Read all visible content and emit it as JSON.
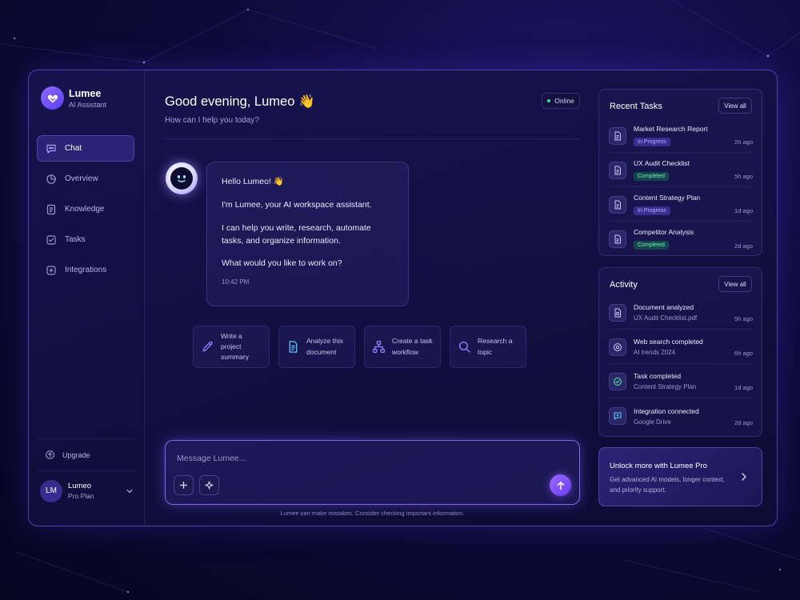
{
  "brand": {
    "name": "Lumee",
    "subtitle": "AI Assistant"
  },
  "nav": [
    {
      "label": "Chat",
      "icon": "chat-icon",
      "active": true
    },
    {
      "label": "Overview",
      "icon": "overview-icon",
      "active": false
    },
    {
      "label": "Knowledge",
      "icon": "document-icon",
      "active": false
    },
    {
      "label": "Tasks",
      "icon": "checkbox-icon",
      "active": false
    },
    {
      "label": "Integrations",
      "icon": "integrations-icon",
      "active": false
    }
  ],
  "upgrade": {
    "label": "Upgrade",
    "icon": "upgrade-icon"
  },
  "user": {
    "initials": "LM",
    "name": "Lumeo",
    "plan": "Pro Plan"
  },
  "header": {
    "greeting": "Good evening, Lumeo 👋",
    "subtitle": "How can I help you today?",
    "status": "Online"
  },
  "message": {
    "line1": "Hello Lumeo! 👋",
    "line2": "I'm Lumee, your AI workspace assistant.",
    "line3": "I can help you write, research, automate tasks, and organize information.",
    "line4": "What would you like to work on?",
    "time": "10:42 PM"
  },
  "suggestions": [
    {
      "line1": "Write a project",
      "line2": "summary",
      "icon": "pencil-icon"
    },
    {
      "line1": "Analyze this",
      "line2": "document",
      "icon": "document-icon"
    },
    {
      "line1": "Create a task",
      "line2": "workflow",
      "icon": "workflow-icon"
    },
    {
      "line1": "Research a",
      "line2": "topic",
      "icon": "search-icon"
    }
  ],
  "composer": {
    "placeholder": "Message Lumee...",
    "disclaimer": "Lumee can make mistakes. Consider checking important information."
  },
  "recent_tasks": {
    "title": "Recent Tasks",
    "view_all": "View all",
    "items": [
      {
        "title": "Market Research Report",
        "status": "In Progress",
        "time": "2h ago"
      },
      {
        "title": "UX Audit Checklist",
        "status": "Completed",
        "time": "5h ago"
      },
      {
        "title": "Content Strategy Plan",
        "status": "In Progress",
        "time": "1d ago"
      },
      {
        "title": "Competitor Analysis",
        "status": "Completed",
        "time": "2d ago"
      }
    ]
  },
  "activity": {
    "title": "Activity",
    "view_all": "View all",
    "items": [
      {
        "title": "Document analyzed",
        "sub": "UX Audit Checklist.pdf",
        "time": "5h ago",
        "icon": "file-icon"
      },
      {
        "title": "Web search completed",
        "sub": "AI trends 2024",
        "time": "6h ago",
        "icon": "globe-icon"
      },
      {
        "title": "Task completed",
        "sub": "Content Strategy Plan",
        "time": "1d ago",
        "icon": "check-circle-icon"
      },
      {
        "title": "Integration connected",
        "sub": "Google Drive",
        "time": "2d ago",
        "icon": "integration-chat-icon"
      }
    ]
  },
  "promo": {
    "title": "Unlock more with Lumee Pro",
    "desc": "Get advanced AI models, longer context, and priority support."
  },
  "colors": {
    "accent": "#7b4dff",
    "success": "#3ee0a0",
    "background": "#0d0a3a"
  }
}
